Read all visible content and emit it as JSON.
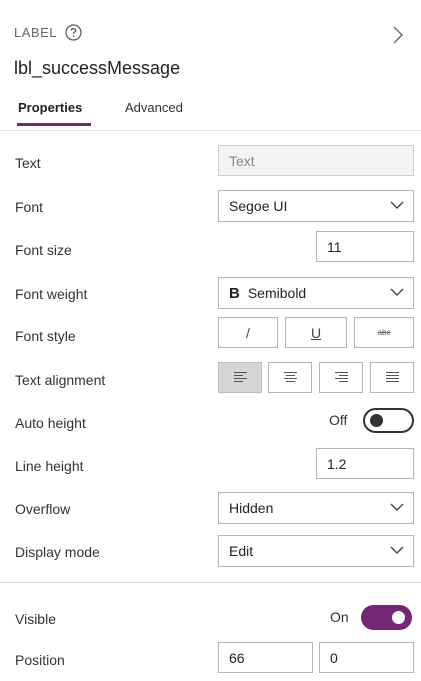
{
  "header": {
    "type_label": "LABEL",
    "control_name": "lbl_successMessage",
    "tabs": [
      {
        "label": "Properties",
        "active": true
      },
      {
        "label": "Advanced",
        "active": false
      }
    ]
  },
  "properties": {
    "text": {
      "label": "Text",
      "value": "Text"
    },
    "font": {
      "label": "Font",
      "value": "Segoe UI"
    },
    "font_size": {
      "label": "Font size",
      "value": "11"
    },
    "font_weight": {
      "label": "Font weight",
      "prefix": "B",
      "value": "Semibold"
    },
    "font_style": {
      "label": "Font style",
      "italic": "/",
      "underline": "U",
      "strikethrough": "abc"
    },
    "text_alignment": {
      "label": "Text alignment",
      "selected": "left"
    },
    "auto_height": {
      "label": "Auto height",
      "state_text": "Off",
      "on": false
    },
    "line_height": {
      "label": "Line height",
      "value": "1.2"
    },
    "overflow": {
      "label": "Overflow",
      "value": "Hidden"
    },
    "display_mode": {
      "label": "Display mode",
      "value": "Edit"
    },
    "visible": {
      "label": "Visible",
      "state_text": "On",
      "on": true
    },
    "position": {
      "label": "Position",
      "x": "66",
      "y": "0"
    }
  },
  "colors": {
    "accent": "#742774"
  },
  "icons": [
    "help-circle-icon",
    "chevron-right-icon",
    "chevron-down-icon",
    "align-left-icon",
    "align-center-icon",
    "align-right-icon",
    "align-justify-icon"
  ]
}
